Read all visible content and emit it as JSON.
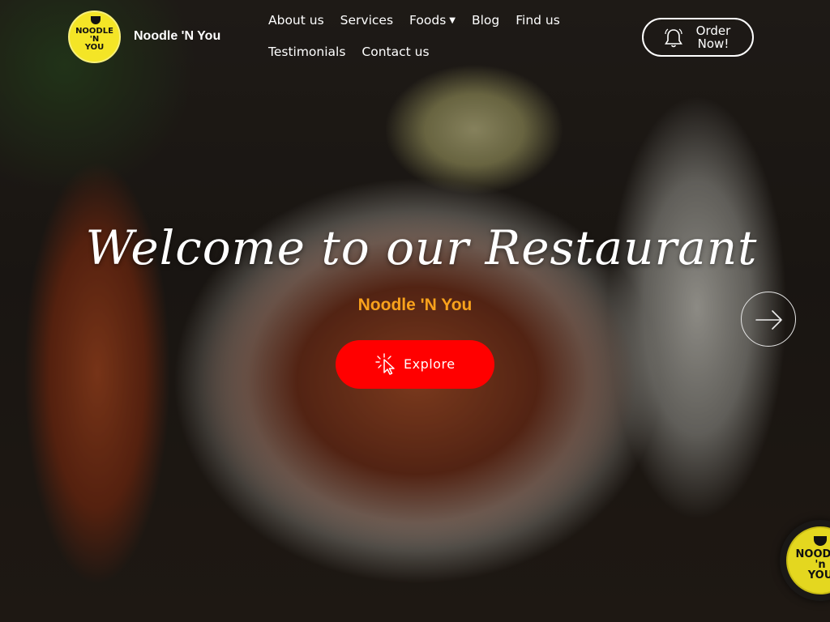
{
  "header": {
    "logo_text": "NOODLE\n'N\nYOU",
    "brand_name": "Noodle 'N You"
  },
  "nav": {
    "items": [
      {
        "label": "About us"
      },
      {
        "label": "Services"
      },
      {
        "label": "Foods",
        "has_dropdown": true
      },
      {
        "label": "Blog"
      },
      {
        "label": "Find us"
      },
      {
        "label": "Testimonials"
      },
      {
        "label": "Contact us"
      }
    ]
  },
  "order_button": {
    "label": "Order\nNow!",
    "icon": "bell-icon"
  },
  "hero": {
    "title": "Welcome to our Restaurant",
    "subtitle": "Noodle 'N You",
    "explore_label": "Explore",
    "explore_icon": "cursor-click-icon",
    "next_icon": "arrow-right-icon"
  },
  "badge": {
    "text": "NOODLE\n'n\nYOU"
  },
  "colors": {
    "accent": "#ff0000",
    "subtitle": "#f9a21c",
    "logo_yellow": "#f4e526"
  }
}
